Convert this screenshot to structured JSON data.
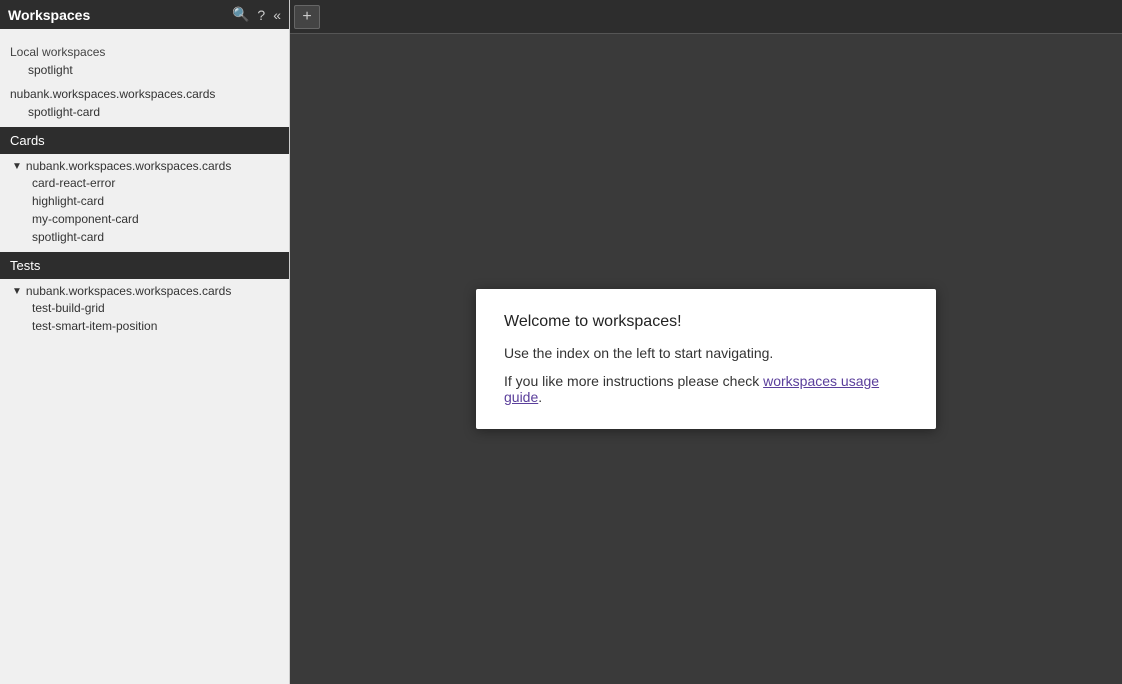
{
  "sidebar": {
    "title": "Workspaces",
    "icons": {
      "search": "🔍",
      "help": "?",
      "collapse": "«"
    },
    "local_workspaces_label": "Local workspaces",
    "local_items": [
      {
        "label": "spotlight"
      }
    ],
    "namespace_local": "nubank.workspaces.workspaces.cards",
    "namespace_local_child": "spotlight-card",
    "sections": [
      {
        "label": "Cards",
        "namespace": "nubank.workspaces.workspaces.cards",
        "children": [
          "card-react-error",
          "highlight-card",
          "my-component-card",
          "spotlight-card"
        ]
      },
      {
        "label": "Tests",
        "namespace": "nubank.workspaces.workspaces.cards",
        "children": [
          "test-build-grid",
          "test-smart-item-position"
        ]
      }
    ]
  },
  "tab_bar": {
    "add_button_label": "+"
  },
  "welcome": {
    "title": "Welcome to workspaces!",
    "subtitle": "Use the index on the left to start navigating.",
    "text_before_link": "If you like more instructions please check ",
    "link_text": "workspaces usage guide",
    "text_after_link": "."
  }
}
